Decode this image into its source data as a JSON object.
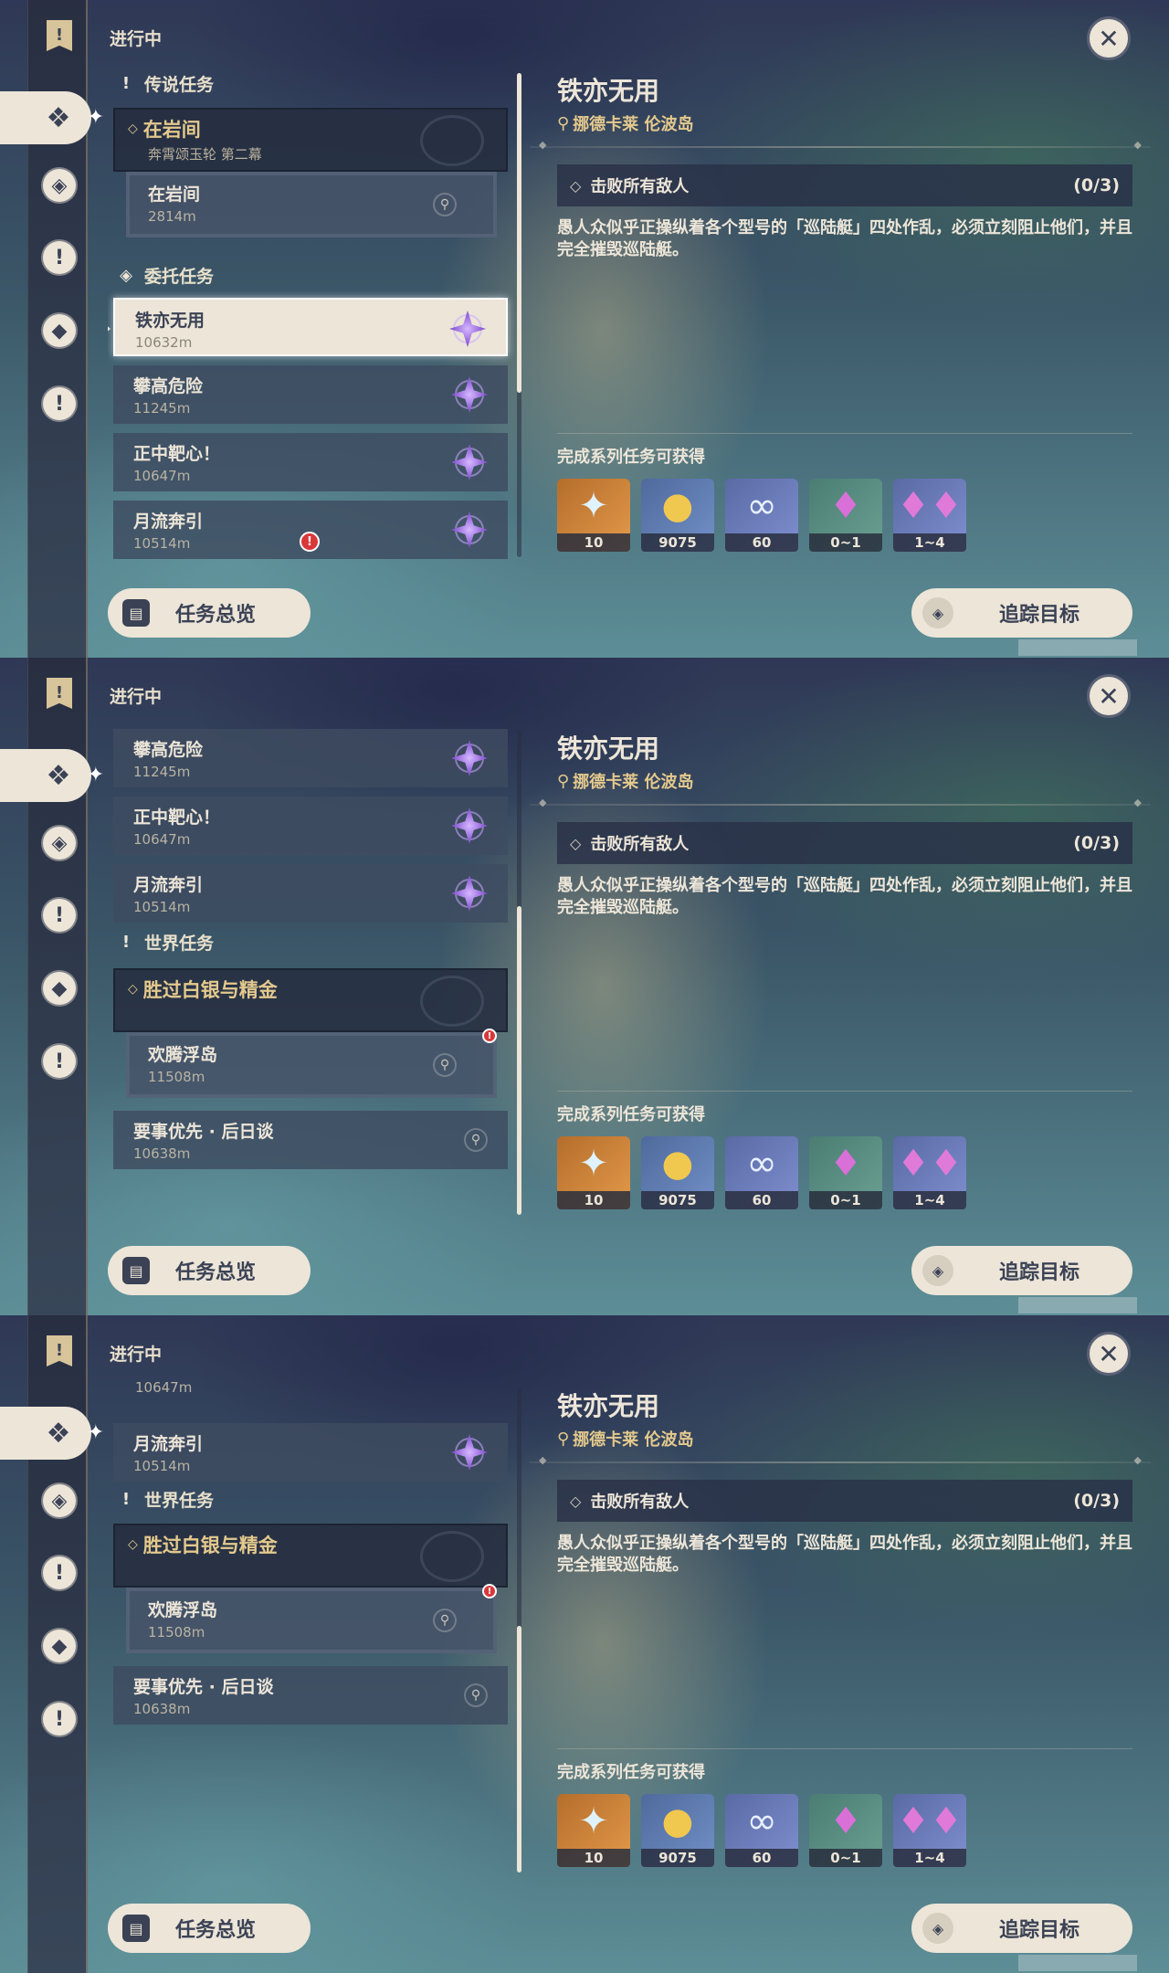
{
  "status_label": "进行中",
  "close_symbol": "✕",
  "overview_button": "任务总览",
  "track_button": "追踪目标",
  "icons": {
    "rail": [
      "quest-book-icon",
      "commission-icon",
      "archon-icon",
      "world-quest-icon",
      "event-icon",
      "exclamation-icon"
    ],
    "pin": "location-pin-icon",
    "star": "commission-star-icon"
  },
  "categories": {
    "legend": "传说任务",
    "commission": "委托任务",
    "world": "世界任务"
  },
  "legend_series": {
    "title": "在岩间",
    "subtitle": "奔霄颂玉轮 第二幕",
    "quest": {
      "name": "在岩间",
      "dist": "2814m"
    }
  },
  "commissions": [
    {
      "name": "铁亦无用",
      "dist": "10632m"
    },
    {
      "name": "攀高危险",
      "dist": "11245m"
    },
    {
      "name": "正中靶心！",
      "dist": "10647m"
    },
    {
      "name": "月流奔引",
      "dist": "10514m"
    }
  ],
  "world_series": {
    "title": "胜过白银与精金",
    "quest": {
      "name": "欢腾浮岛",
      "dist": "11508m"
    }
  },
  "world_single": {
    "name": "要事优先 · 后日谈",
    "dist": "10638m"
  },
  "partial_dist": "10647m",
  "detail": {
    "title": "铁亦无用",
    "location": "挪德卡莱 伦波岛",
    "objective": "击败所有敌人",
    "objective_count": "(0/3)",
    "description": "愚人众似乎正操纵着各个型号的「巡陆艇」四处作乱，必须立刻阻止他们，并且完全摧毁巡陆艇。",
    "rewards_label": "完成系列任务可获得",
    "rewards": [
      {
        "icon": "primogem-icon",
        "qty": "10"
      },
      {
        "icon": "mora-icon",
        "qty": "9075"
      },
      {
        "icon": "adventure-exp-icon",
        "qty": "60"
      },
      {
        "icon": "crystal-icon",
        "qty": "0~1"
      },
      {
        "icon": "crystal-cluster-icon",
        "qty": "1~4"
      }
    ]
  },
  "colors": {
    "cream": "#ece5d8",
    "gold_text": "#e4c98d",
    "dark": "#3b4255",
    "alert": "#d8383a"
  }
}
